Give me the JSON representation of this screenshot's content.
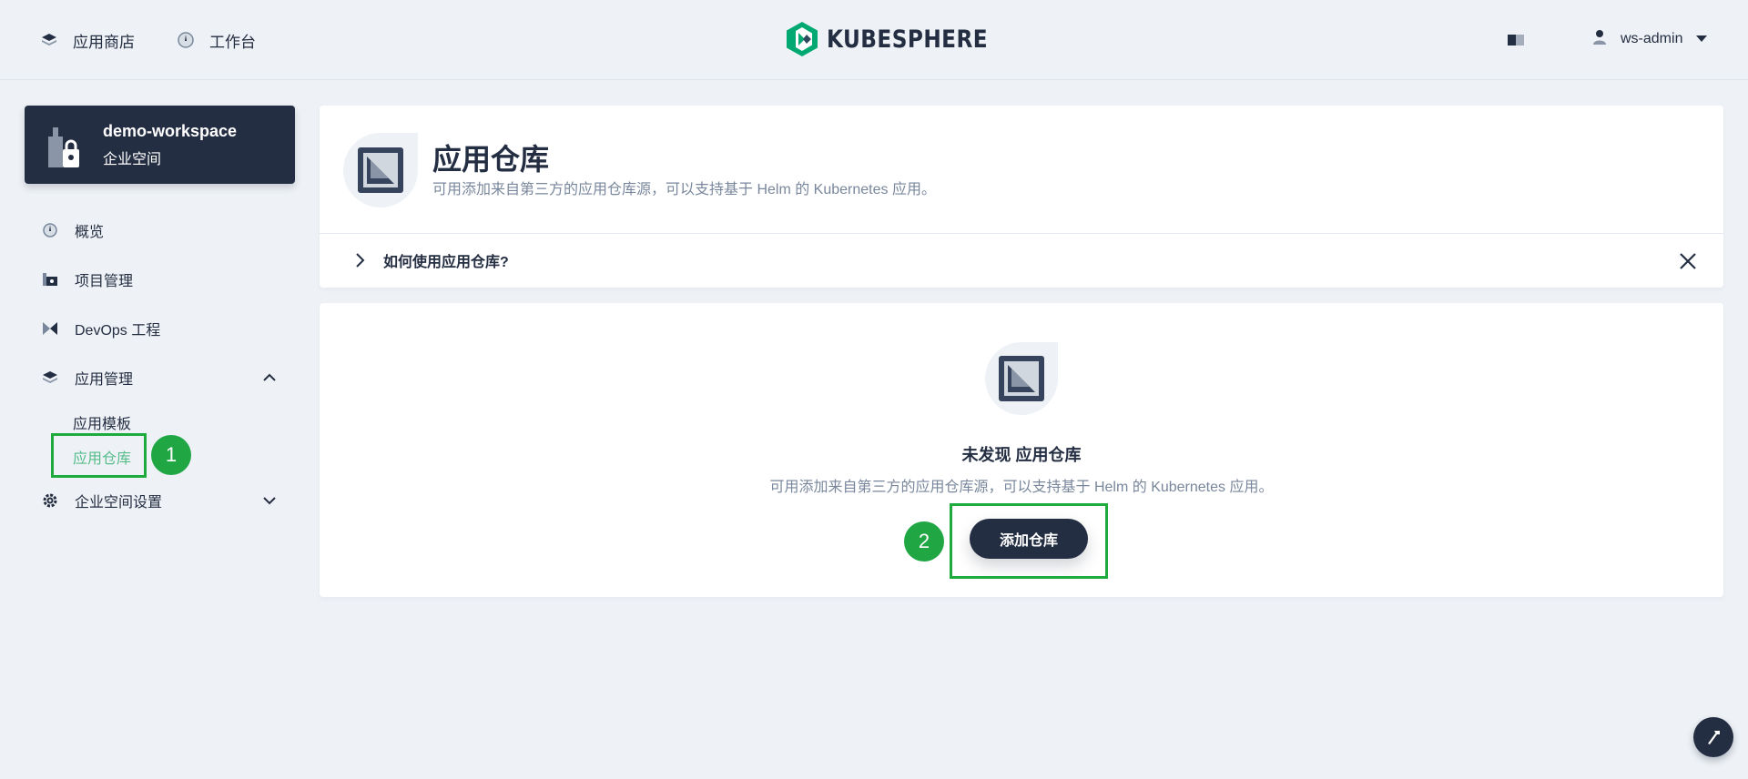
{
  "topnav": {
    "app_store": "应用商店",
    "workbench": "工作台",
    "logo_text": "KUBESPHERE",
    "username": "ws-admin"
  },
  "workspace": {
    "name": "demo-workspace",
    "type": "企业空间"
  },
  "sidebar": {
    "items": [
      {
        "label": "概览",
        "icon": "dashboard-icon"
      },
      {
        "label": "项目管理",
        "icon": "project-icon"
      },
      {
        "label": "DevOps 工程",
        "icon": "devops-icon"
      },
      {
        "label": "应用管理",
        "icon": "appstore-icon"
      },
      {
        "label": "企业空间设置",
        "icon": "gear-icon"
      }
    ],
    "app_children": [
      {
        "label": "应用模板"
      },
      {
        "label": "应用仓库"
      }
    ]
  },
  "header": {
    "title": "应用仓库",
    "description": "可用添加来自第三方的应用仓库源，可以支持基于 Helm 的 Kubernetes 应用。",
    "howto": "如何使用应用仓库?"
  },
  "empty": {
    "title": "未发现 应用仓库",
    "description": "可用添加来自第三方的应用仓库源，可以支持基于 Helm 的 Kubernetes 应用。",
    "button": "添加仓库"
  },
  "annotations": {
    "step1": "1",
    "step2": "2"
  },
  "colors": {
    "accent": "#55bc8a",
    "dark": "#242e42",
    "highlight": "#1faa3e"
  }
}
